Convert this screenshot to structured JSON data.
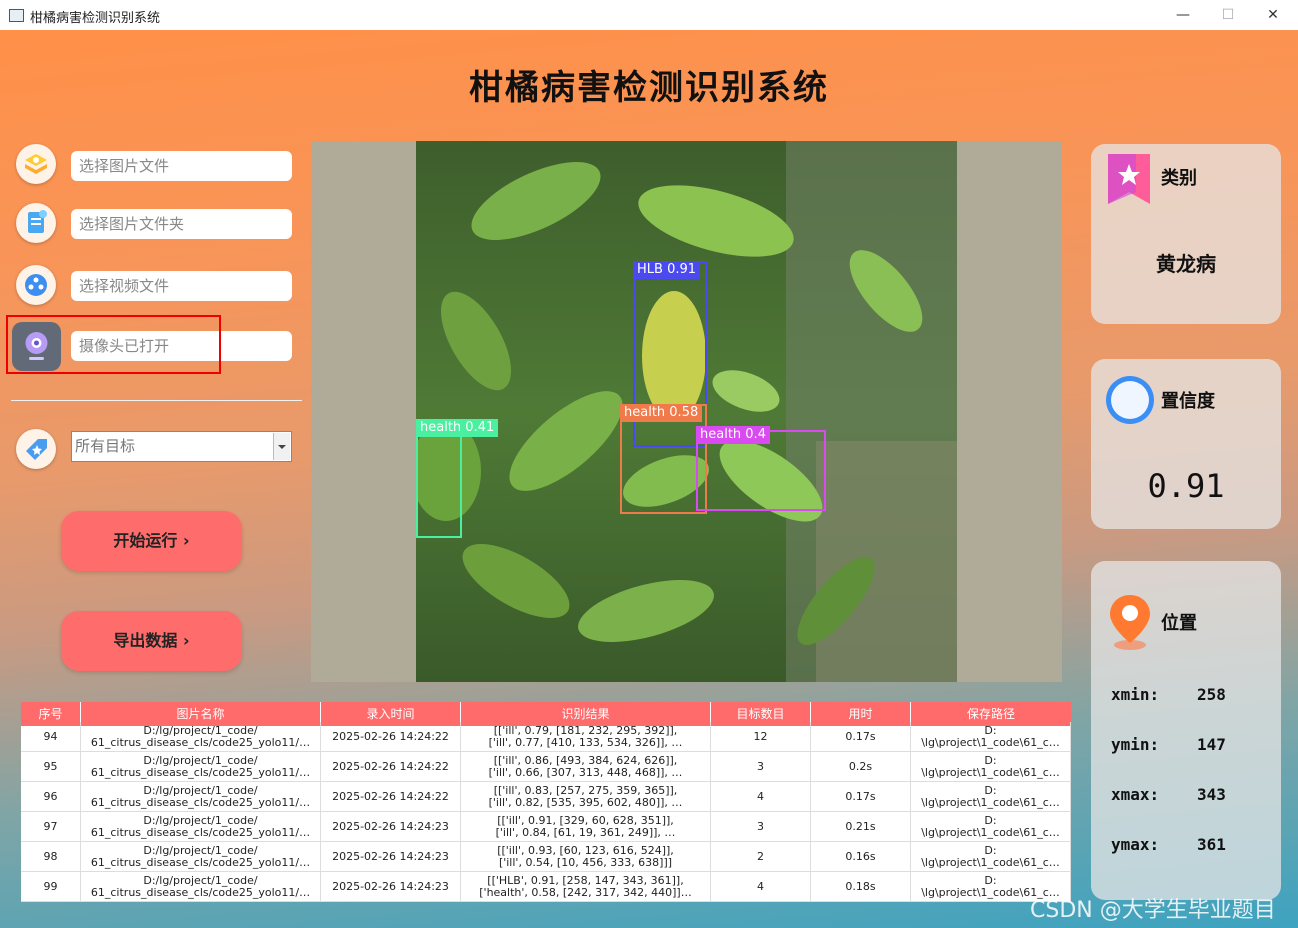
{
  "window": {
    "title": "柑橘病害检测识别系统",
    "minimize": "—",
    "maximize": "☐",
    "close": "✕"
  },
  "app": {
    "heading": "柑橘病害检测识别系统"
  },
  "inputs": {
    "image_file": "选择图片文件",
    "image_folder": "选择图片文件夹",
    "video_file": "选择视频文件",
    "camera": "摄像头已打开"
  },
  "target_select": {
    "value": "所有目标"
  },
  "buttons": {
    "run": "开始运行 ›",
    "export": "导出数据 ›"
  },
  "detections": [
    {
      "label": "HLB 0.91",
      "color": "#4a4af0"
    },
    {
      "label": "health 0.58",
      "color": "#f07a4a"
    },
    {
      "label": "health 0.4",
      "color": "#d94af0"
    },
    {
      "label": "health 0.41",
      "color": "#4af0a0"
    }
  ],
  "cards": {
    "category": {
      "label": "类别",
      "value": "黄龙病"
    },
    "confidence": {
      "label": "置信度",
      "value": "0.91"
    },
    "position": {
      "label": "位置",
      "xmin_label": "xmin:",
      "xmin": "258",
      "ymin_label": "ymin:",
      "ymin": "147",
      "xmax_label": "xmax:",
      "xmax": "343",
      "ymax_label": "ymax:",
      "ymax": "361"
    }
  },
  "table": {
    "headers": [
      "序号",
      "图片名称",
      "录入时间",
      "识别结果",
      "目标数目",
      "用时",
      "保存路径"
    ],
    "rows": [
      {
        "id": "94",
        "name1": "D:/lg/project/1_code/",
        "name2": "61_citrus_disease_cls/code25_yolo11/…",
        "time": "2025-02-26 14:24:22",
        "res1": "[['ill', 0.79, [181, 232, 295, 392]],",
        "res2": "['ill', 0.77, [410, 133, 534, 326]], …",
        "count": "12",
        "dur": "0.17s",
        "path1": "D:",
        "path2": "\\lg\\project\\1_code\\61_c…"
      },
      {
        "id": "95",
        "name1": "D:/lg/project/1_code/",
        "name2": "61_citrus_disease_cls/code25_yolo11/…",
        "time": "2025-02-26 14:24:22",
        "res1": "[['ill', 0.86, [493, 384, 624, 626]],",
        "res2": "['ill', 0.66, [307, 313, 448, 468]], …",
        "count": "3",
        "dur": "0.2s",
        "path1": "D:",
        "path2": "\\lg\\project\\1_code\\61_c…"
      },
      {
        "id": "96",
        "name1": "D:/lg/project/1_code/",
        "name2": "61_citrus_disease_cls/code25_yolo11/…",
        "time": "2025-02-26 14:24:22",
        "res1": "[['ill', 0.83, [257, 275, 359, 365]],",
        "res2": "['ill', 0.82, [535, 395, 602, 480]], …",
        "count": "4",
        "dur": "0.17s",
        "path1": "D:",
        "path2": "\\lg\\project\\1_code\\61_c…"
      },
      {
        "id": "97",
        "name1": "D:/lg/project/1_code/",
        "name2": "61_citrus_disease_cls/code25_yolo11/…",
        "time": "2025-02-26 14:24:23",
        "res1": "[['ill', 0.91, [329, 60, 628, 351]],",
        "res2": "['ill', 0.84, [61, 19, 361, 249]], …",
        "count": "3",
        "dur": "0.21s",
        "path1": "D:",
        "path2": "\\lg\\project\\1_code\\61_c…"
      },
      {
        "id": "98",
        "name1": "D:/lg/project/1_code/",
        "name2": "61_citrus_disease_cls/code25_yolo11/…",
        "time": "2025-02-26 14:24:23",
        "res1": "[['ill', 0.93, [60, 123, 616, 524]],",
        "res2": "['ill', 0.54, [10, 456, 333, 638]]]",
        "count": "2",
        "dur": "0.16s",
        "path1": "D:",
        "path2": "\\lg\\project\\1_code\\61_c…"
      },
      {
        "id": "99",
        "name1": "D:/lg/project/1_code/",
        "name2": "61_citrus_disease_cls/code25_yolo11/…",
        "time": "2025-02-26 14:24:23",
        "res1": "[['HLB', 0.91, [258, 147, 343, 361]],",
        "res2": "['health', 0.58, [242, 317, 342, 440]]…",
        "count": "4",
        "dur": "0.18s",
        "path1": "D:",
        "path2": "\\lg\\project\\1_code\\61_c…"
      }
    ]
  },
  "watermark": "CSDN @大学生毕业题目"
}
